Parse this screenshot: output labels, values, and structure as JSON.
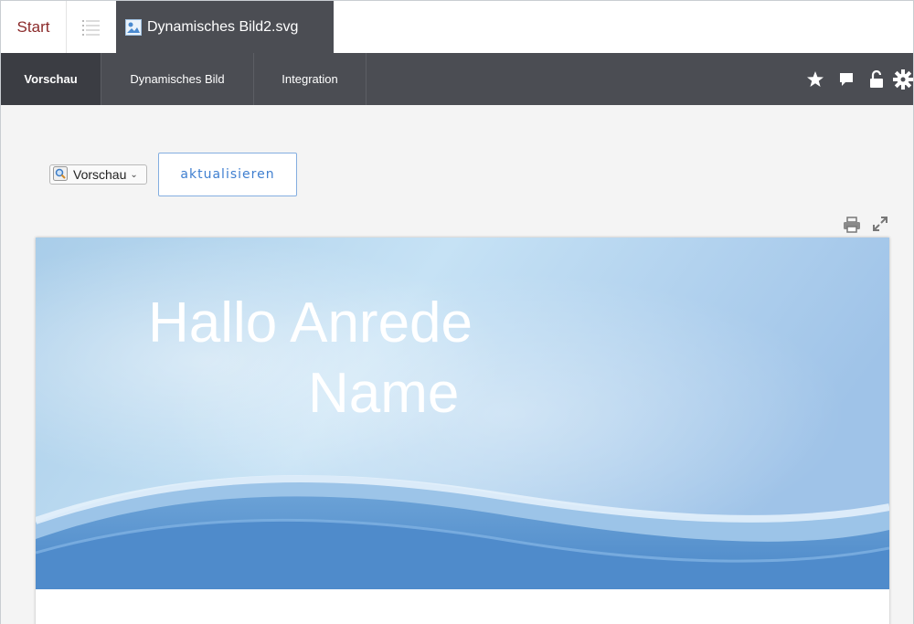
{
  "tabs": {
    "start_label": "Start",
    "file_label": "Dynamisches Bild2.svg"
  },
  "nav": {
    "items": [
      {
        "label": "Vorschau",
        "active": true
      },
      {
        "label": "Dynamisches Bild",
        "active": false
      },
      {
        "label": "Integration",
        "active": false
      }
    ],
    "icons": [
      "star-icon",
      "comment-icon",
      "unlock-icon",
      "gear-icon"
    ]
  },
  "toolbar": {
    "preview_select_value": "Vorschau",
    "refresh_label": "aktualisieren"
  },
  "banner": {
    "line1": "Hallo Anrede",
    "line2": "Name"
  },
  "colors": {
    "nav_bg": "#4b4d53",
    "start_text": "#8b2a2a",
    "button_accent": "#3f7fd0"
  }
}
